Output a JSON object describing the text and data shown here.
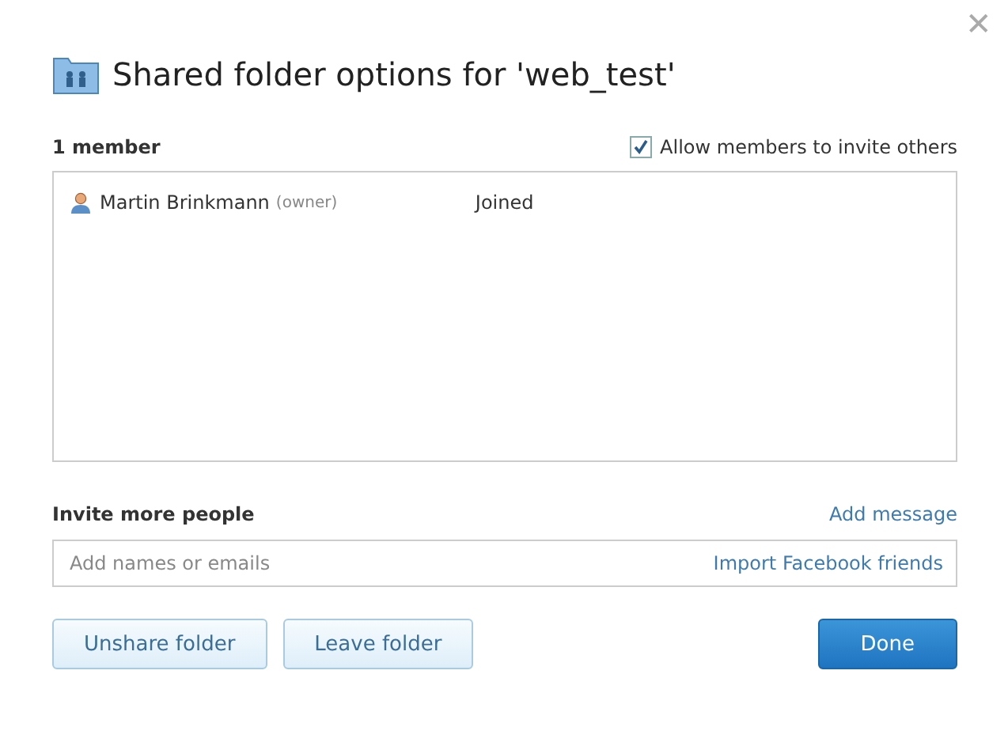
{
  "dialog": {
    "title": "Shared folder options for 'web_test'",
    "close_label": "✕"
  },
  "members_header": {
    "count": "1 member",
    "allow_invite": {
      "label": "Allow members to invite others",
      "checked": true
    }
  },
  "members": [
    {
      "name": "Martin Brinkmann",
      "role": "(owner)",
      "status": "Joined"
    }
  ],
  "invite": {
    "label": "Invite more people",
    "add_message": "Add message",
    "placeholder": "Add names or emails",
    "import_link": "Import Facebook friends"
  },
  "buttons": [
    {
      "label": "Unshare folder",
      "kind": "secondary"
    },
    {
      "label": "Leave folder",
      "kind": "secondary"
    },
    {
      "label": "Done",
      "kind": "primary"
    }
  ]
}
